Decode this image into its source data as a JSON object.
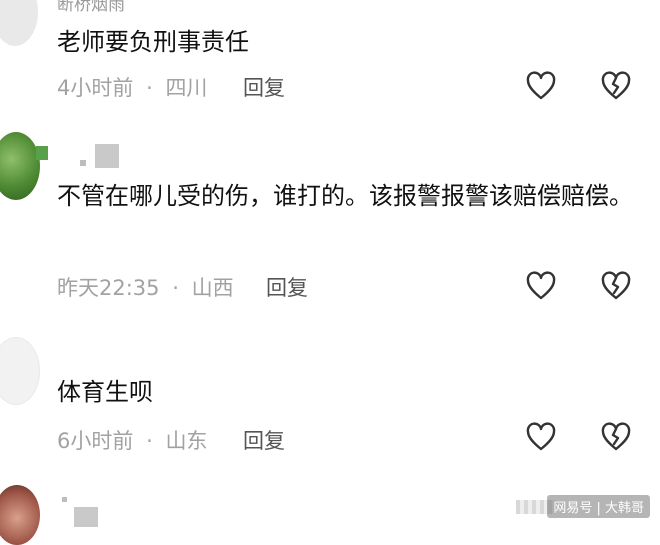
{
  "comments": [
    {
      "username": "断桥烟雨",
      "text": "老师要负刑事责任",
      "time": "4小时前",
      "location": "四川",
      "reply": "回复"
    },
    {
      "username": "",
      "text": "不管在哪儿受的伤，谁打的。该报警报警该赔偿赔偿。",
      "time": "昨天22:35",
      "location": "山西",
      "reply": "回复"
    },
    {
      "username": "",
      "text": "体育生呗",
      "time": "6小时前",
      "location": "山东",
      "reply": "回复"
    }
  ],
  "separator": "·",
  "watermark": "网易号 | 大韩哥",
  "icons": {
    "like": "heart-icon",
    "dislike": "broken-heart-icon"
  }
}
